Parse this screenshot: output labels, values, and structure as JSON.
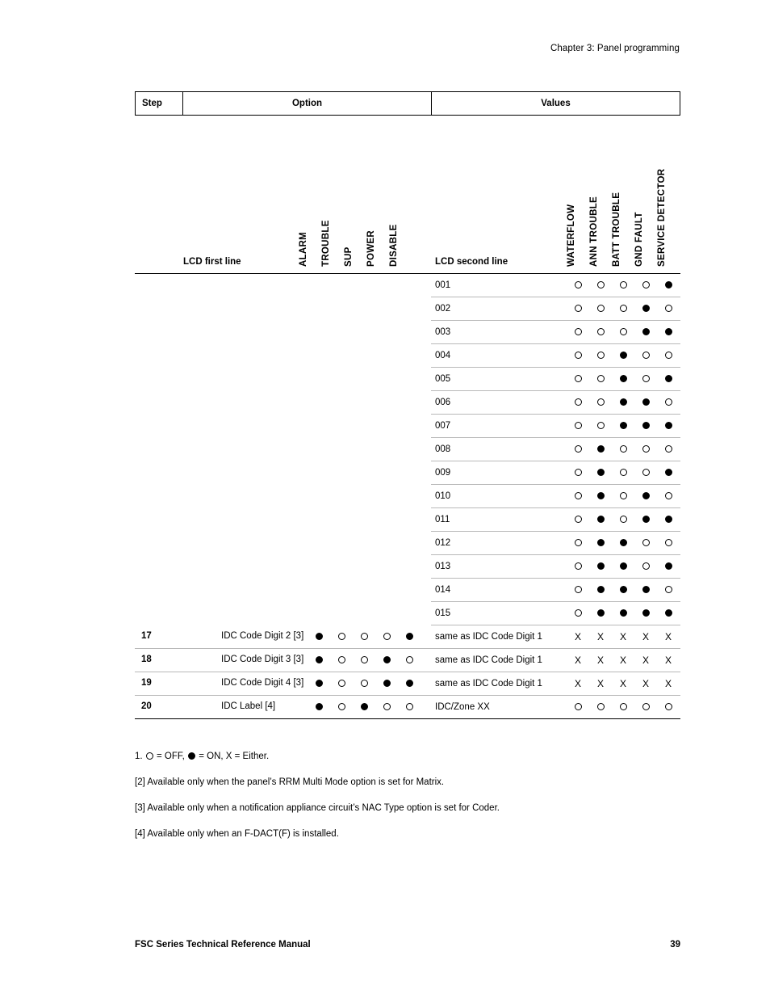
{
  "running_head": "Chapter 3: Panel programming",
  "table": {
    "header": {
      "step": "Step",
      "option": "Option",
      "values": "Values"
    },
    "subheader": {
      "lcd_first_line": "LCD first line",
      "lcd_second_line": "LCD second line",
      "option_columns": [
        "ALARM",
        "TROUBLE",
        "SUP",
        "POWER",
        "DISABLE"
      ],
      "value_columns": [
        "WATERFLOW",
        "ANN TROUBLE",
        "BATT TROUBLE",
        "GND FAULT",
        "SERVICE DETECTOR"
      ]
    },
    "rows": [
      {
        "step": "",
        "option": "",
        "option_marks": [],
        "second": "001",
        "value_marks": [
          "off",
          "off",
          "off",
          "off",
          "on"
        ],
        "rule": "partial"
      },
      {
        "step": "",
        "option": "",
        "option_marks": [],
        "second": "002",
        "value_marks": [
          "off",
          "off",
          "off",
          "on",
          "off"
        ],
        "rule": "partial"
      },
      {
        "step": "",
        "option": "",
        "option_marks": [],
        "second": "003",
        "value_marks": [
          "off",
          "off",
          "off",
          "on",
          "on"
        ],
        "rule": "partial"
      },
      {
        "step": "",
        "option": "",
        "option_marks": [],
        "second": "004",
        "value_marks": [
          "off",
          "off",
          "on",
          "off",
          "off"
        ],
        "rule": "partial"
      },
      {
        "step": "",
        "option": "",
        "option_marks": [],
        "second": "005",
        "value_marks": [
          "off",
          "off",
          "on",
          "off",
          "on"
        ],
        "rule": "partial"
      },
      {
        "step": "",
        "option": "",
        "option_marks": [],
        "second": "006",
        "value_marks": [
          "off",
          "off",
          "on",
          "on",
          "off"
        ],
        "rule": "partial"
      },
      {
        "step": "",
        "option": "",
        "option_marks": [],
        "second": "007",
        "value_marks": [
          "off",
          "off",
          "on",
          "on",
          "on"
        ],
        "rule": "partial"
      },
      {
        "step": "",
        "option": "",
        "option_marks": [],
        "second": "008",
        "value_marks": [
          "off",
          "on",
          "off",
          "off",
          "off"
        ],
        "rule": "partial"
      },
      {
        "step": "",
        "option": "",
        "option_marks": [],
        "second": "009",
        "value_marks": [
          "off",
          "on",
          "off",
          "off",
          "on"
        ],
        "rule": "partial"
      },
      {
        "step": "",
        "option": "",
        "option_marks": [],
        "second": "010",
        "value_marks": [
          "off",
          "on",
          "off",
          "on",
          "off"
        ],
        "rule": "partial"
      },
      {
        "step": "",
        "option": "",
        "option_marks": [],
        "second": "011",
        "value_marks": [
          "off",
          "on",
          "off",
          "on",
          "on"
        ],
        "rule": "partial"
      },
      {
        "step": "",
        "option": "",
        "option_marks": [],
        "second": "012",
        "value_marks": [
          "off",
          "on",
          "on",
          "off",
          "off"
        ],
        "rule": "partial"
      },
      {
        "step": "",
        "option": "",
        "option_marks": [],
        "second": "013",
        "value_marks": [
          "off",
          "on",
          "on",
          "off",
          "on"
        ],
        "rule": "partial"
      },
      {
        "step": "",
        "option": "",
        "option_marks": [],
        "second": "014",
        "value_marks": [
          "off",
          "on",
          "on",
          "on",
          "off"
        ],
        "rule": "partial"
      },
      {
        "step": "",
        "option": "",
        "option_marks": [],
        "second": "015",
        "value_marks": [
          "off",
          "on",
          "on",
          "on",
          "on"
        ],
        "rule": "partial"
      },
      {
        "step": "17",
        "option": "IDC Code Digit 2 [3]",
        "option_marks": [
          "on",
          "off",
          "off",
          "off",
          "on"
        ],
        "second": "same as IDC Code Digit 1",
        "value_marks": [
          "x",
          "x",
          "x",
          "x",
          "x"
        ],
        "rule": "full"
      },
      {
        "step": "18",
        "option": "IDC Code Digit 3 [3]",
        "option_marks": [
          "on",
          "off",
          "off",
          "on",
          "off"
        ],
        "second": "same as IDC Code Digit 1",
        "value_marks": [
          "x",
          "x",
          "x",
          "x",
          "x"
        ],
        "rule": "full"
      },
      {
        "step": "19",
        "option": "IDC Code Digit 4 [3]",
        "option_marks": [
          "on",
          "off",
          "off",
          "on",
          "on"
        ],
        "second": "same as IDC Code Digit 1",
        "value_marks": [
          "x",
          "x",
          "x",
          "x",
          "x"
        ],
        "rule": "full"
      },
      {
        "step": "20",
        "option": "IDC Label [4]",
        "option_marks": [
          "on",
          "off",
          "on",
          "off",
          "off"
        ],
        "second": "IDC/Zone XX",
        "value_marks": [
          "off",
          "off",
          "off",
          "off",
          "off"
        ],
        "rule": "lastrow"
      }
    ]
  },
  "notes": [
    {
      "prefix": "1. ",
      "mid1": " = OFF, ",
      "mid2": " = ON, X = Either.",
      "legend_off": "off",
      "legend_on": "on"
    },
    {
      "text": "[2] Available only when the panel’s RRM Multi Mode option is set for Matrix."
    },
    {
      "text": "[3] Available only when a notification appliance circuit’s NAC Type option is set for Coder."
    },
    {
      "text": "[4] Available only when an F-DACT(F) is installed."
    }
  ],
  "footer": {
    "title": "FSC Series Technical Reference Manual",
    "page": "39"
  }
}
